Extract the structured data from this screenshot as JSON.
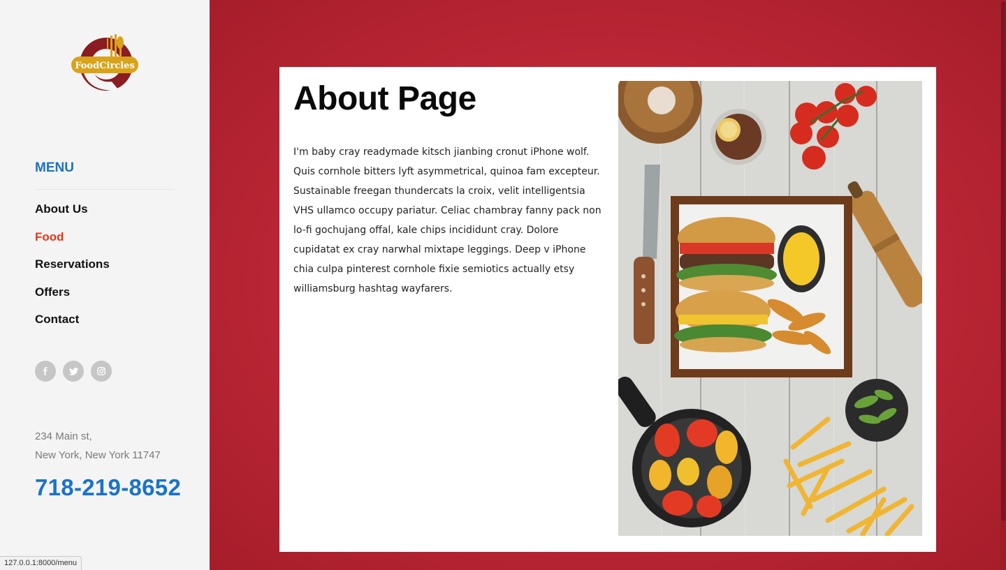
{
  "brand": {
    "logo_text": "FoodCircles"
  },
  "menu": {
    "heading": "MENU",
    "items": [
      {
        "label": "About Us",
        "active": false
      },
      {
        "label": "Food",
        "active": true
      },
      {
        "label": "Reservations",
        "active": false
      },
      {
        "label": "Offers",
        "active": false
      },
      {
        "label": "Contact",
        "active": false
      }
    ]
  },
  "social": [
    {
      "icon": "facebook-icon"
    },
    {
      "icon": "twitter-icon"
    },
    {
      "icon": "instagram-icon"
    }
  ],
  "contact": {
    "address_line1": "234 Main st,",
    "address_line2": "New York, New York 11747",
    "phone": "718-219-8652"
  },
  "page": {
    "title": "About Page",
    "body": "I'm baby cray readymade kitsch jianbing cronut iPhone wolf. Quis cornhole bitters lyft asymmetrical, quinoa fam excepteur. Sustainable freegan thundercats la croix, velit intelligentsia VHS ullamco occupy pariatur. Celiac chambray fanny pack non lo-fi gochujang offal, kale chips incididunt cray. Dolore cupidatat ex cray narwhal mixtape leggings. Deep v iPhone chia culpa pinterest cornhole fixie semiotics actually etsy williamsburg hashtag wayfarers."
  },
  "status_bar": {
    "url": "127.0.0.1:8000/menu"
  },
  "colors": {
    "accent_blue": "#1a73c8",
    "active_red": "#e83413",
    "background_red": "#bb2635",
    "logo_gold": "#d9a21b",
    "logo_maroon": "#8a1c22"
  }
}
